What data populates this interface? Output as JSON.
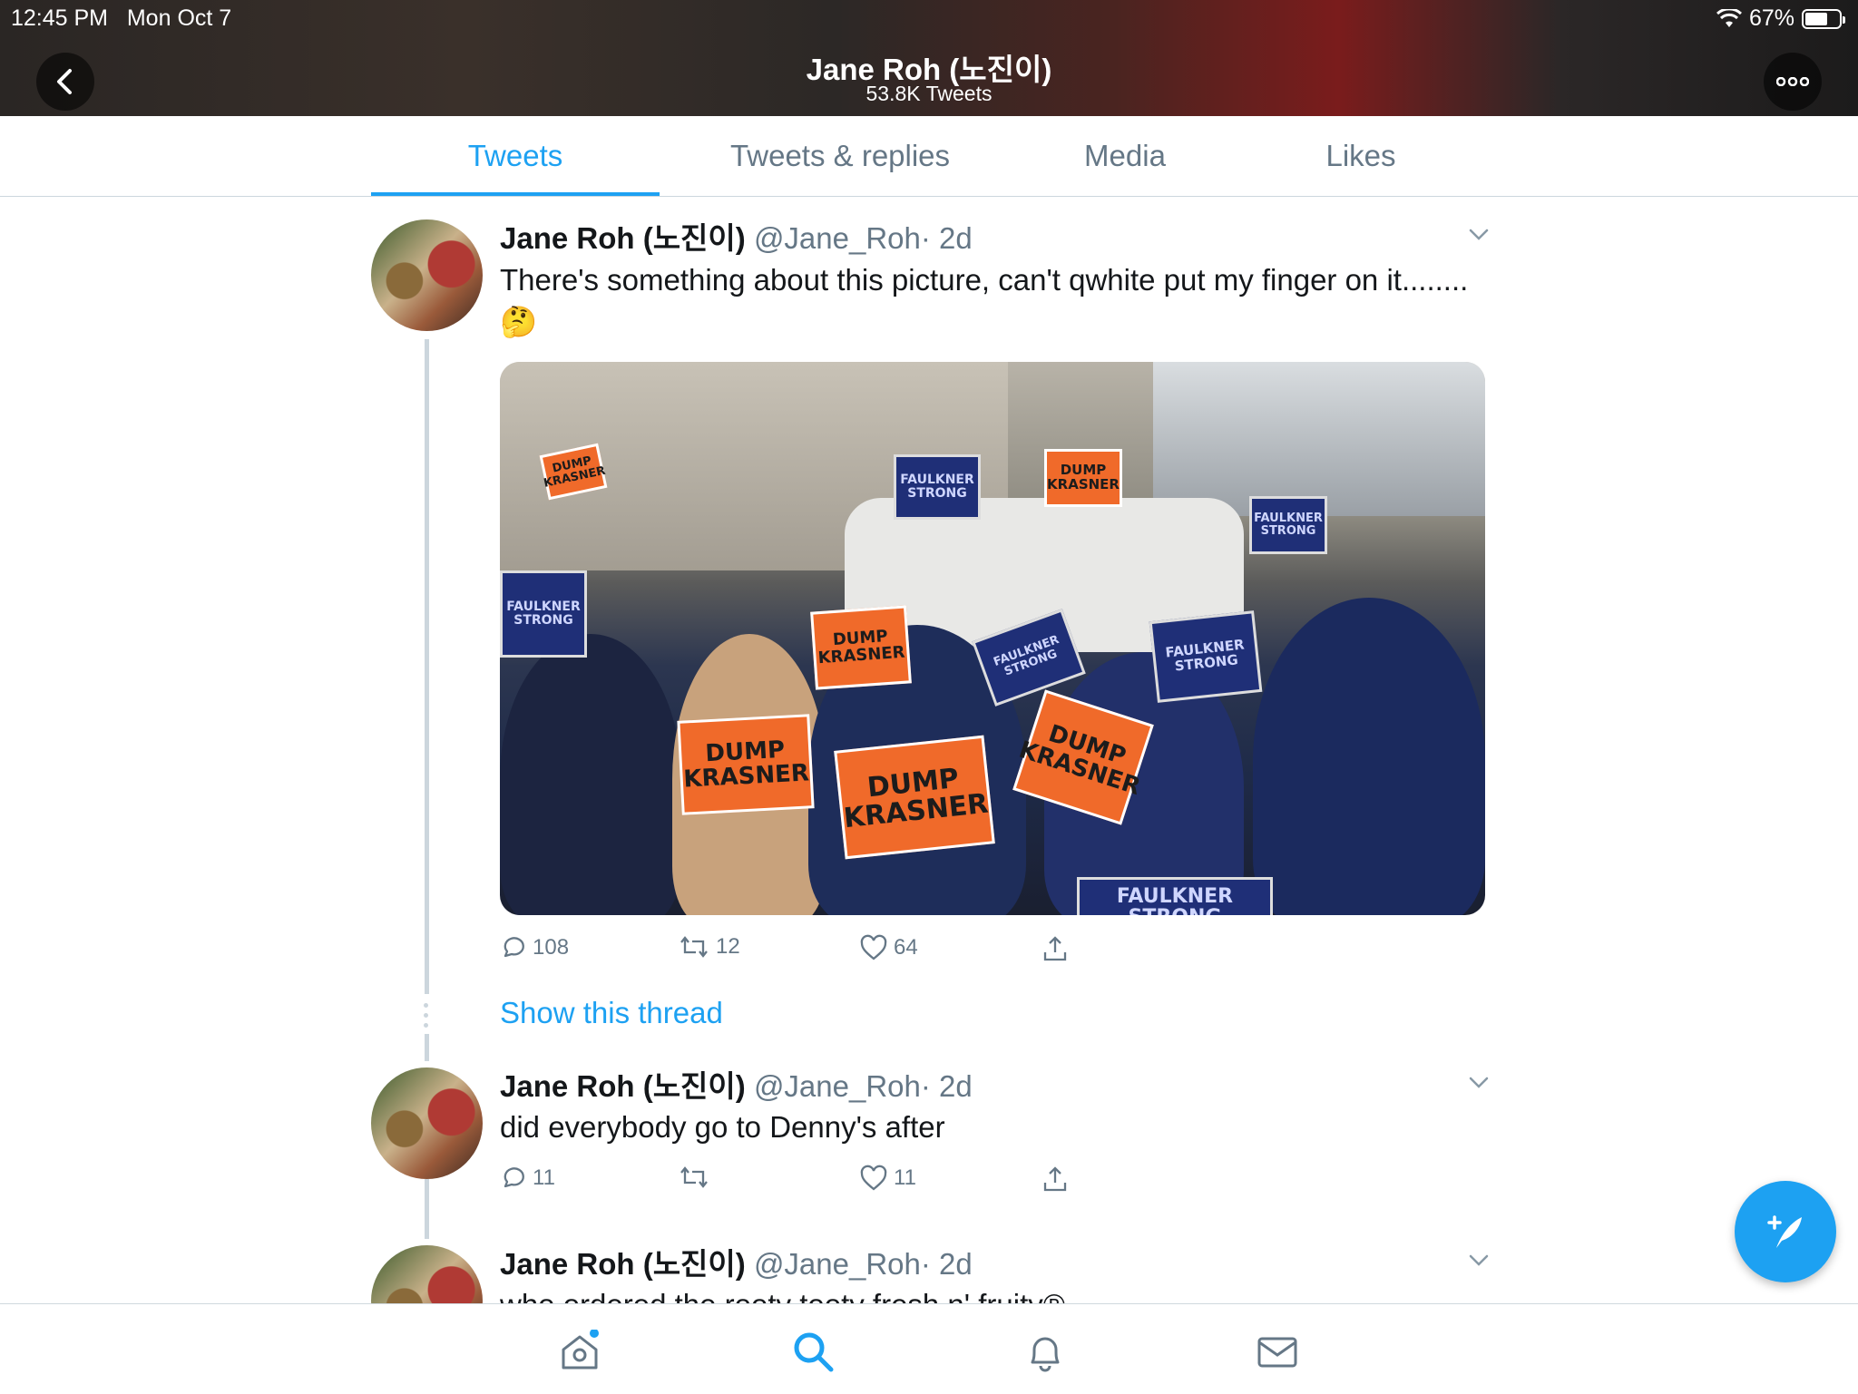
{
  "status_bar": {
    "time": "12:45 PM",
    "date": "Mon Oct 7",
    "battery": "67%",
    "battery_level": 0.67
  },
  "header": {
    "title": "Jane Roh (노진이)",
    "subtitle": "53.8K Tweets"
  },
  "tabs": [
    {
      "label": "Tweets",
      "active": true
    },
    {
      "label": "Tweets & replies",
      "active": false
    },
    {
      "label": "Media",
      "active": false
    },
    {
      "label": "Likes",
      "active": false
    }
  ],
  "tweets": [
    {
      "name": "Jane Roh (노진이)",
      "handle": "@Jane_Roh",
      "time": "· 2d",
      "text": "There's something about this picture, can't qwhite put my finger on it........ 🤔",
      "replies": "108",
      "retweets": "12",
      "likes": "64"
    },
    {
      "name": "Jane Roh (노진이)",
      "handle": "@Jane_Roh",
      "time": "· 2d",
      "text": "did everybody go to Denny's after",
      "replies": "11",
      "retweets": "",
      "likes": "11"
    },
    {
      "name": "Jane Roh (노진이)",
      "handle": "@Jane_Roh",
      "time": "· 2d",
      "text": "who ordered the rooty tooty fresh n' fruity®"
    }
  ],
  "photo_signs": {
    "dump_krasner": "DUMP KRASNER",
    "faulkner_strong": "FAULKNER STRONG",
    "dump": "DUMP",
    "krasner": "KRASNER"
  },
  "show_thread": "Show this thread",
  "colors": {
    "accent": "#1da1f2",
    "muted": "#657786",
    "text": "#14171a"
  },
  "icons": [
    "back-arrow-icon",
    "more-icon",
    "chevron-down-icon",
    "reply-icon",
    "retweet-icon",
    "like-icon",
    "share-icon",
    "compose-icon",
    "home-icon",
    "search-icon",
    "notifications-icon",
    "messages-icon",
    "wifi-icon",
    "battery-icon"
  ]
}
